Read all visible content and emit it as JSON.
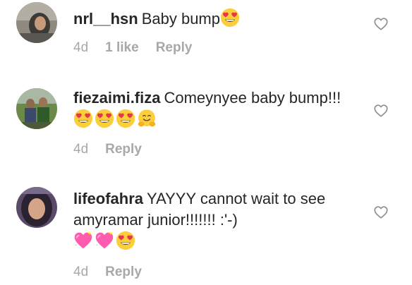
{
  "comments": [
    {
      "username": "nrl__hsn",
      "text": "Baby bump",
      "time": "4d",
      "likes": "1 like",
      "reply": "Reply",
      "emojis": [
        "heart-eyes-emoji"
      ]
    },
    {
      "username": "fiezaimi.fiza",
      "text": "Comeynyee baby bump!!!",
      "time": "4d",
      "reply": "Reply",
      "emojis": [
        "heart-eyes-emoji",
        "heart-eyes-emoji",
        "heart-eyes-emoji",
        "hugging-emoji"
      ]
    },
    {
      "username": "lifeofahra",
      "text": "YAYYY cannot wait to see amyramar junior!!!!!!! :'-)",
      "time": "4d",
      "reply": "Reply",
      "emojis": [
        "sparkling-heart-emoji",
        "sparkling-heart-emoji",
        "heart-eyes-emoji"
      ]
    }
  ],
  "icons": {
    "like": "heart-outline-icon"
  },
  "colors": {
    "text": "#262626",
    "meta": "#a8a8a8",
    "heart_outline": "#8e8e8e",
    "emoji_yellow": "#fbcf3b",
    "emoji_red": "#e7354b",
    "sparkle_pink": "#ff5cb0"
  }
}
